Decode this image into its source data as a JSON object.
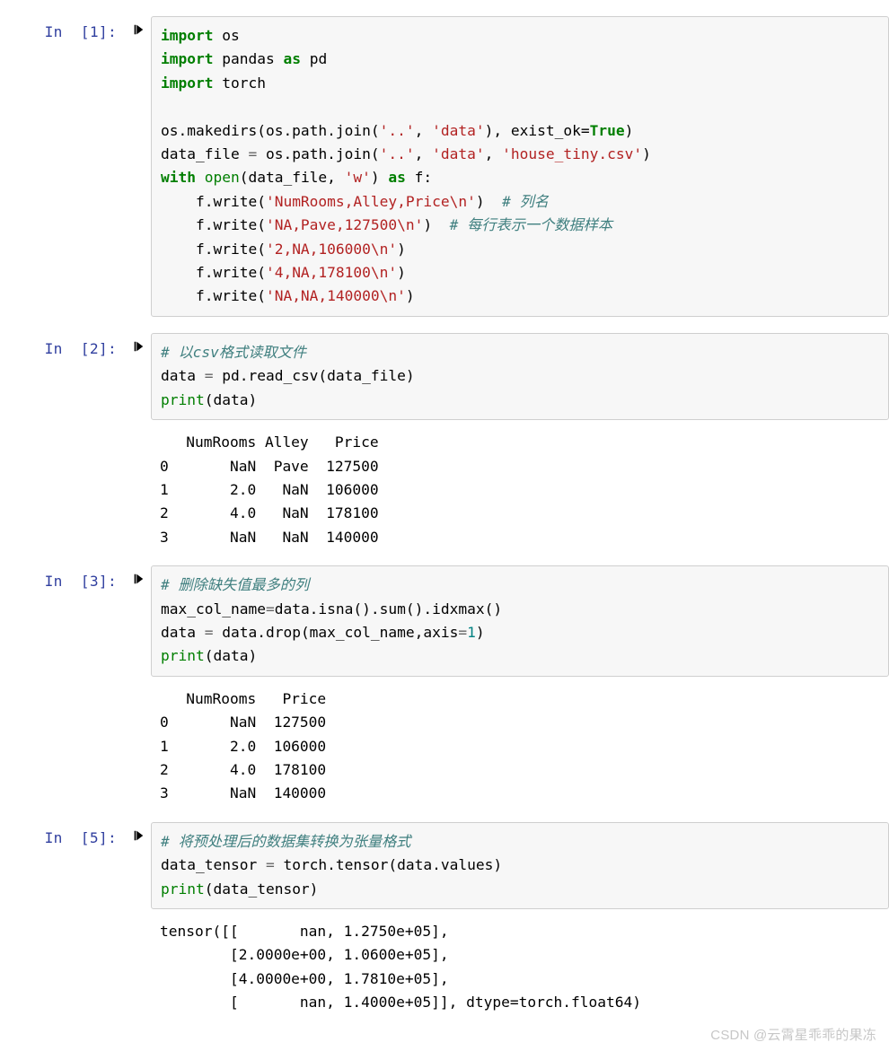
{
  "cells": [
    {
      "prompt": "In  [1]:",
      "code": [
        [
          {
            "t": "kw",
            "v": "import"
          },
          {
            "t": "id",
            "v": " os"
          }
        ],
        [
          {
            "t": "kw",
            "v": "import"
          },
          {
            "t": "id",
            "v": " pandas "
          },
          {
            "t": "kw",
            "v": "as"
          },
          {
            "t": "id",
            "v": " pd"
          }
        ],
        [
          {
            "t": "kw",
            "v": "import"
          },
          {
            "t": "id",
            "v": " torch"
          }
        ],
        [],
        [
          {
            "t": "id",
            "v": "os.makedirs(os.path.join("
          },
          {
            "t": "str",
            "v": "'..'"
          },
          {
            "t": "id",
            "v": ", "
          },
          {
            "t": "str",
            "v": "'data'"
          },
          {
            "t": "id",
            "v": "), exist_ok="
          },
          {
            "t": "kw",
            "v": "True"
          },
          {
            "t": "id",
            "v": ")"
          }
        ],
        [
          {
            "t": "id",
            "v": "data_file "
          },
          {
            "t": "op",
            "v": "="
          },
          {
            "t": "id",
            "v": " os.path.join("
          },
          {
            "t": "str",
            "v": "'..'"
          },
          {
            "t": "id",
            "v": ", "
          },
          {
            "t": "str",
            "v": "'data'"
          },
          {
            "t": "id",
            "v": ", "
          },
          {
            "t": "str",
            "v": "'house_tiny.csv'"
          },
          {
            "t": "id",
            "v": ")"
          }
        ],
        [
          {
            "t": "kw",
            "v": "with"
          },
          {
            "t": "id",
            "v": " "
          },
          {
            "t": "builtin",
            "v": "open"
          },
          {
            "t": "id",
            "v": "(data_file, "
          },
          {
            "t": "str",
            "v": "'w'"
          },
          {
            "t": "id",
            "v": ") "
          },
          {
            "t": "kw",
            "v": "as"
          },
          {
            "t": "id",
            "v": " f:"
          }
        ],
        [
          {
            "t": "id",
            "v": "    f.write("
          },
          {
            "t": "str",
            "v": "'NumRooms,Alley,Price\\n'"
          },
          {
            "t": "id",
            "v": ")  "
          },
          {
            "t": "cmt",
            "v": "# 列名"
          }
        ],
        [
          {
            "t": "id",
            "v": "    f.write("
          },
          {
            "t": "str",
            "v": "'NA,Pave,127500\\n'"
          },
          {
            "t": "id",
            "v": ")  "
          },
          {
            "t": "cmt",
            "v": "# 每行表示一个数据样本"
          }
        ],
        [
          {
            "t": "id",
            "v": "    f.write("
          },
          {
            "t": "str",
            "v": "'2,NA,106000\\n'"
          },
          {
            "t": "id",
            "v": ")"
          }
        ],
        [
          {
            "t": "id",
            "v": "    f.write("
          },
          {
            "t": "str",
            "v": "'4,NA,178100\\n'"
          },
          {
            "t": "id",
            "v": ")"
          }
        ],
        [
          {
            "t": "id",
            "v": "    f.write("
          },
          {
            "t": "str",
            "v": "'NA,NA,140000\\n'"
          },
          {
            "t": "id",
            "v": ")"
          }
        ]
      ],
      "output": []
    },
    {
      "prompt": "In  [2]:",
      "code": [
        [
          {
            "t": "cmt",
            "v": "# 以csv格式读取文件"
          }
        ],
        [
          {
            "t": "id",
            "v": "data "
          },
          {
            "t": "op",
            "v": "="
          },
          {
            "t": "id",
            "v": " pd.read_csv(data_file)"
          }
        ],
        [
          {
            "t": "builtin",
            "v": "print"
          },
          {
            "t": "id",
            "v": "(data)"
          }
        ]
      ],
      "output": [
        "   NumRooms Alley   Price",
        "0       NaN  Pave  127500",
        "1       2.0   NaN  106000",
        "2       4.0   NaN  178100",
        "3       NaN   NaN  140000"
      ]
    },
    {
      "prompt": "In  [3]:",
      "code": [
        [
          {
            "t": "cmt",
            "v": "# 删除缺失值最多的列"
          }
        ],
        [
          {
            "t": "id",
            "v": "max_col_name"
          },
          {
            "t": "op",
            "v": "="
          },
          {
            "t": "id",
            "v": "data.isna().sum().idxmax()"
          }
        ],
        [
          {
            "t": "id",
            "v": "data "
          },
          {
            "t": "op",
            "v": "="
          },
          {
            "t": "id",
            "v": " data.drop(max_col_name,axis"
          },
          {
            "t": "op",
            "v": "="
          },
          {
            "t": "num",
            "v": "1"
          },
          {
            "t": "id",
            "v": ")"
          }
        ],
        [
          {
            "t": "builtin",
            "v": "print"
          },
          {
            "t": "id",
            "v": "(data)"
          }
        ]
      ],
      "output": [
        "   NumRooms   Price",
        "0       NaN  127500",
        "1       2.0  106000",
        "2       4.0  178100",
        "3       NaN  140000"
      ]
    },
    {
      "prompt": "In  [5]:",
      "code": [
        [
          {
            "t": "cmt",
            "v": "# 将预处理后的数据集转换为张量格式"
          }
        ],
        [
          {
            "t": "id",
            "v": "data_tensor "
          },
          {
            "t": "op",
            "v": "="
          },
          {
            "t": "id",
            "v": " torch.tensor(data.values)"
          }
        ],
        [
          {
            "t": "builtin",
            "v": "print"
          },
          {
            "t": "id",
            "v": "(data_tensor)"
          }
        ]
      ],
      "output": [
        "tensor([[       nan, 1.2750e+05],",
        "        [2.0000e+00, 1.0600e+05],",
        "        [4.0000e+00, 1.7810e+05],",
        "        [       nan, 1.4000e+05]], dtype=torch.float64)"
      ]
    }
  ],
  "watermark": "CSDN @云霄星乖乖的果冻"
}
